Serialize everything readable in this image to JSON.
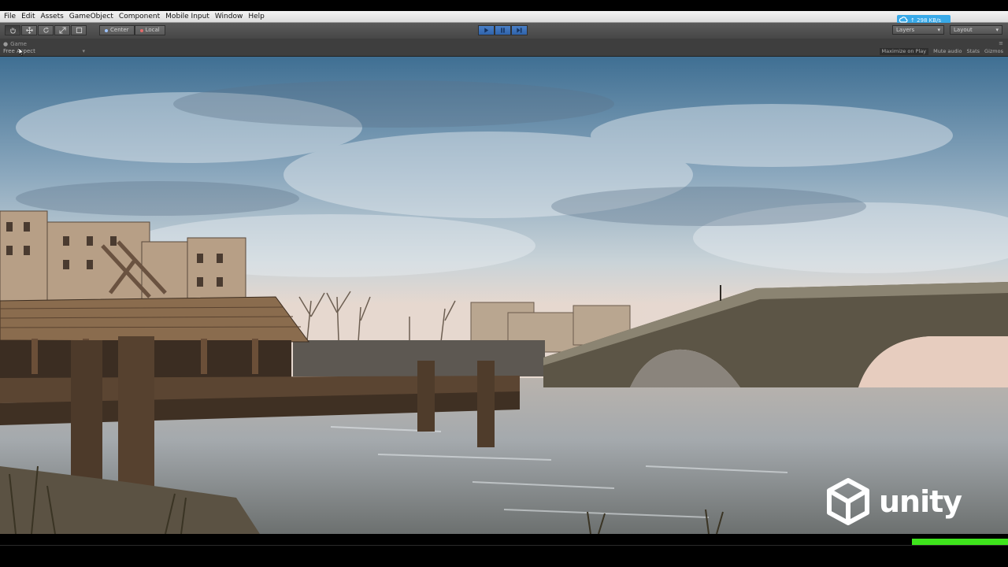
{
  "menu": [
    "File",
    "Edit",
    "Assets",
    "GameObject",
    "Component",
    "Mobile Input",
    "Window",
    "Help"
  ],
  "network": {
    "label": "↑ 298 KB/s",
    "icon": "cloud-sync-icon",
    "color": "#38a9e8"
  },
  "toolbar": {
    "tools": [
      "hand-icon",
      "move-icon",
      "rotate-icon",
      "scale-icon",
      "rect-icon"
    ],
    "pivot": {
      "center": "Center",
      "local": "Local"
    },
    "play": [
      "play-icon",
      "pause-icon",
      "step-icon"
    ],
    "layers": "Layers",
    "layout": "Layout"
  },
  "game": {
    "tab": "Game",
    "aspect": "Free Aspect",
    "options": [
      "Maximize on Play",
      "Mute audio",
      "Stats",
      "Gizmos"
    ]
  },
  "logo": {
    "text": "unity"
  },
  "colors": {
    "accent": "#3a79c6",
    "status_bar": "#3ee41c"
  }
}
